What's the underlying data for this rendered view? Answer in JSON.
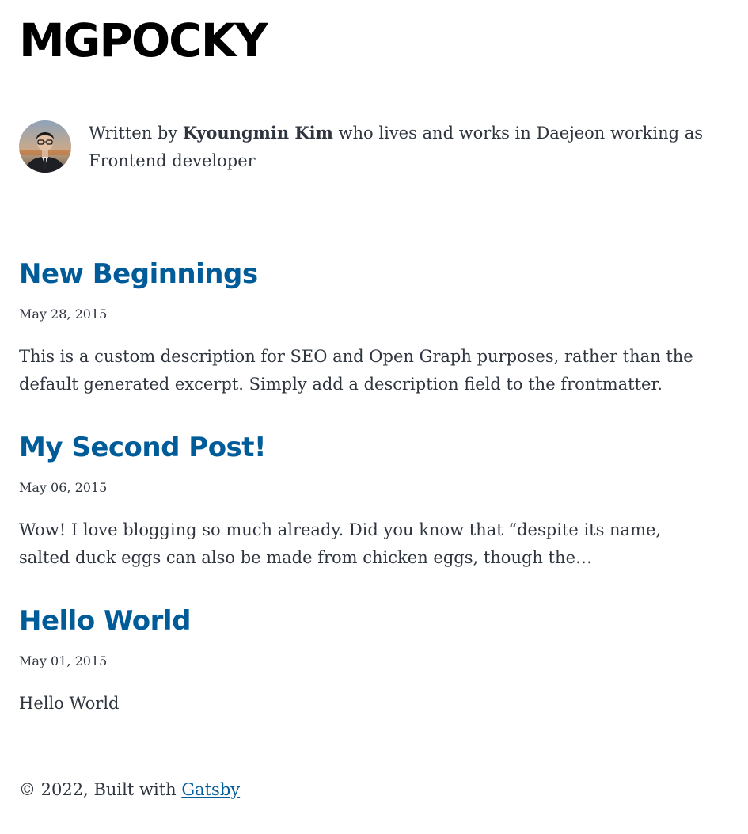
{
  "site": {
    "title": "MGPOCKY"
  },
  "bio": {
    "prefix": "Written by ",
    "author": "Kyoungmin Kim",
    "suffix": " who lives and works in Daejeon working as Frontend developer"
  },
  "posts": [
    {
      "title": "New Beginnings",
      "date": "May 28, 2015",
      "description": "This is a custom description for SEO and Open Graph purposes, rather than the default generated excerpt. Simply add a description field to the frontmatter."
    },
    {
      "title": "My Second Post!",
      "date": "May 06, 2015",
      "description": "Wow! I love blogging so much already. Did you know that “despite its name, salted duck eggs can also be made from chicken eggs, though the…"
    },
    {
      "title": "Hello World",
      "date": "May 01, 2015",
      "description": "Hello World"
    }
  ],
  "footer": {
    "prefix": "© 2022, Built with ",
    "link_label": "Gatsby"
  },
  "colors": {
    "link": "#005b99",
    "text": "#2e353f",
    "title": "#000000"
  }
}
